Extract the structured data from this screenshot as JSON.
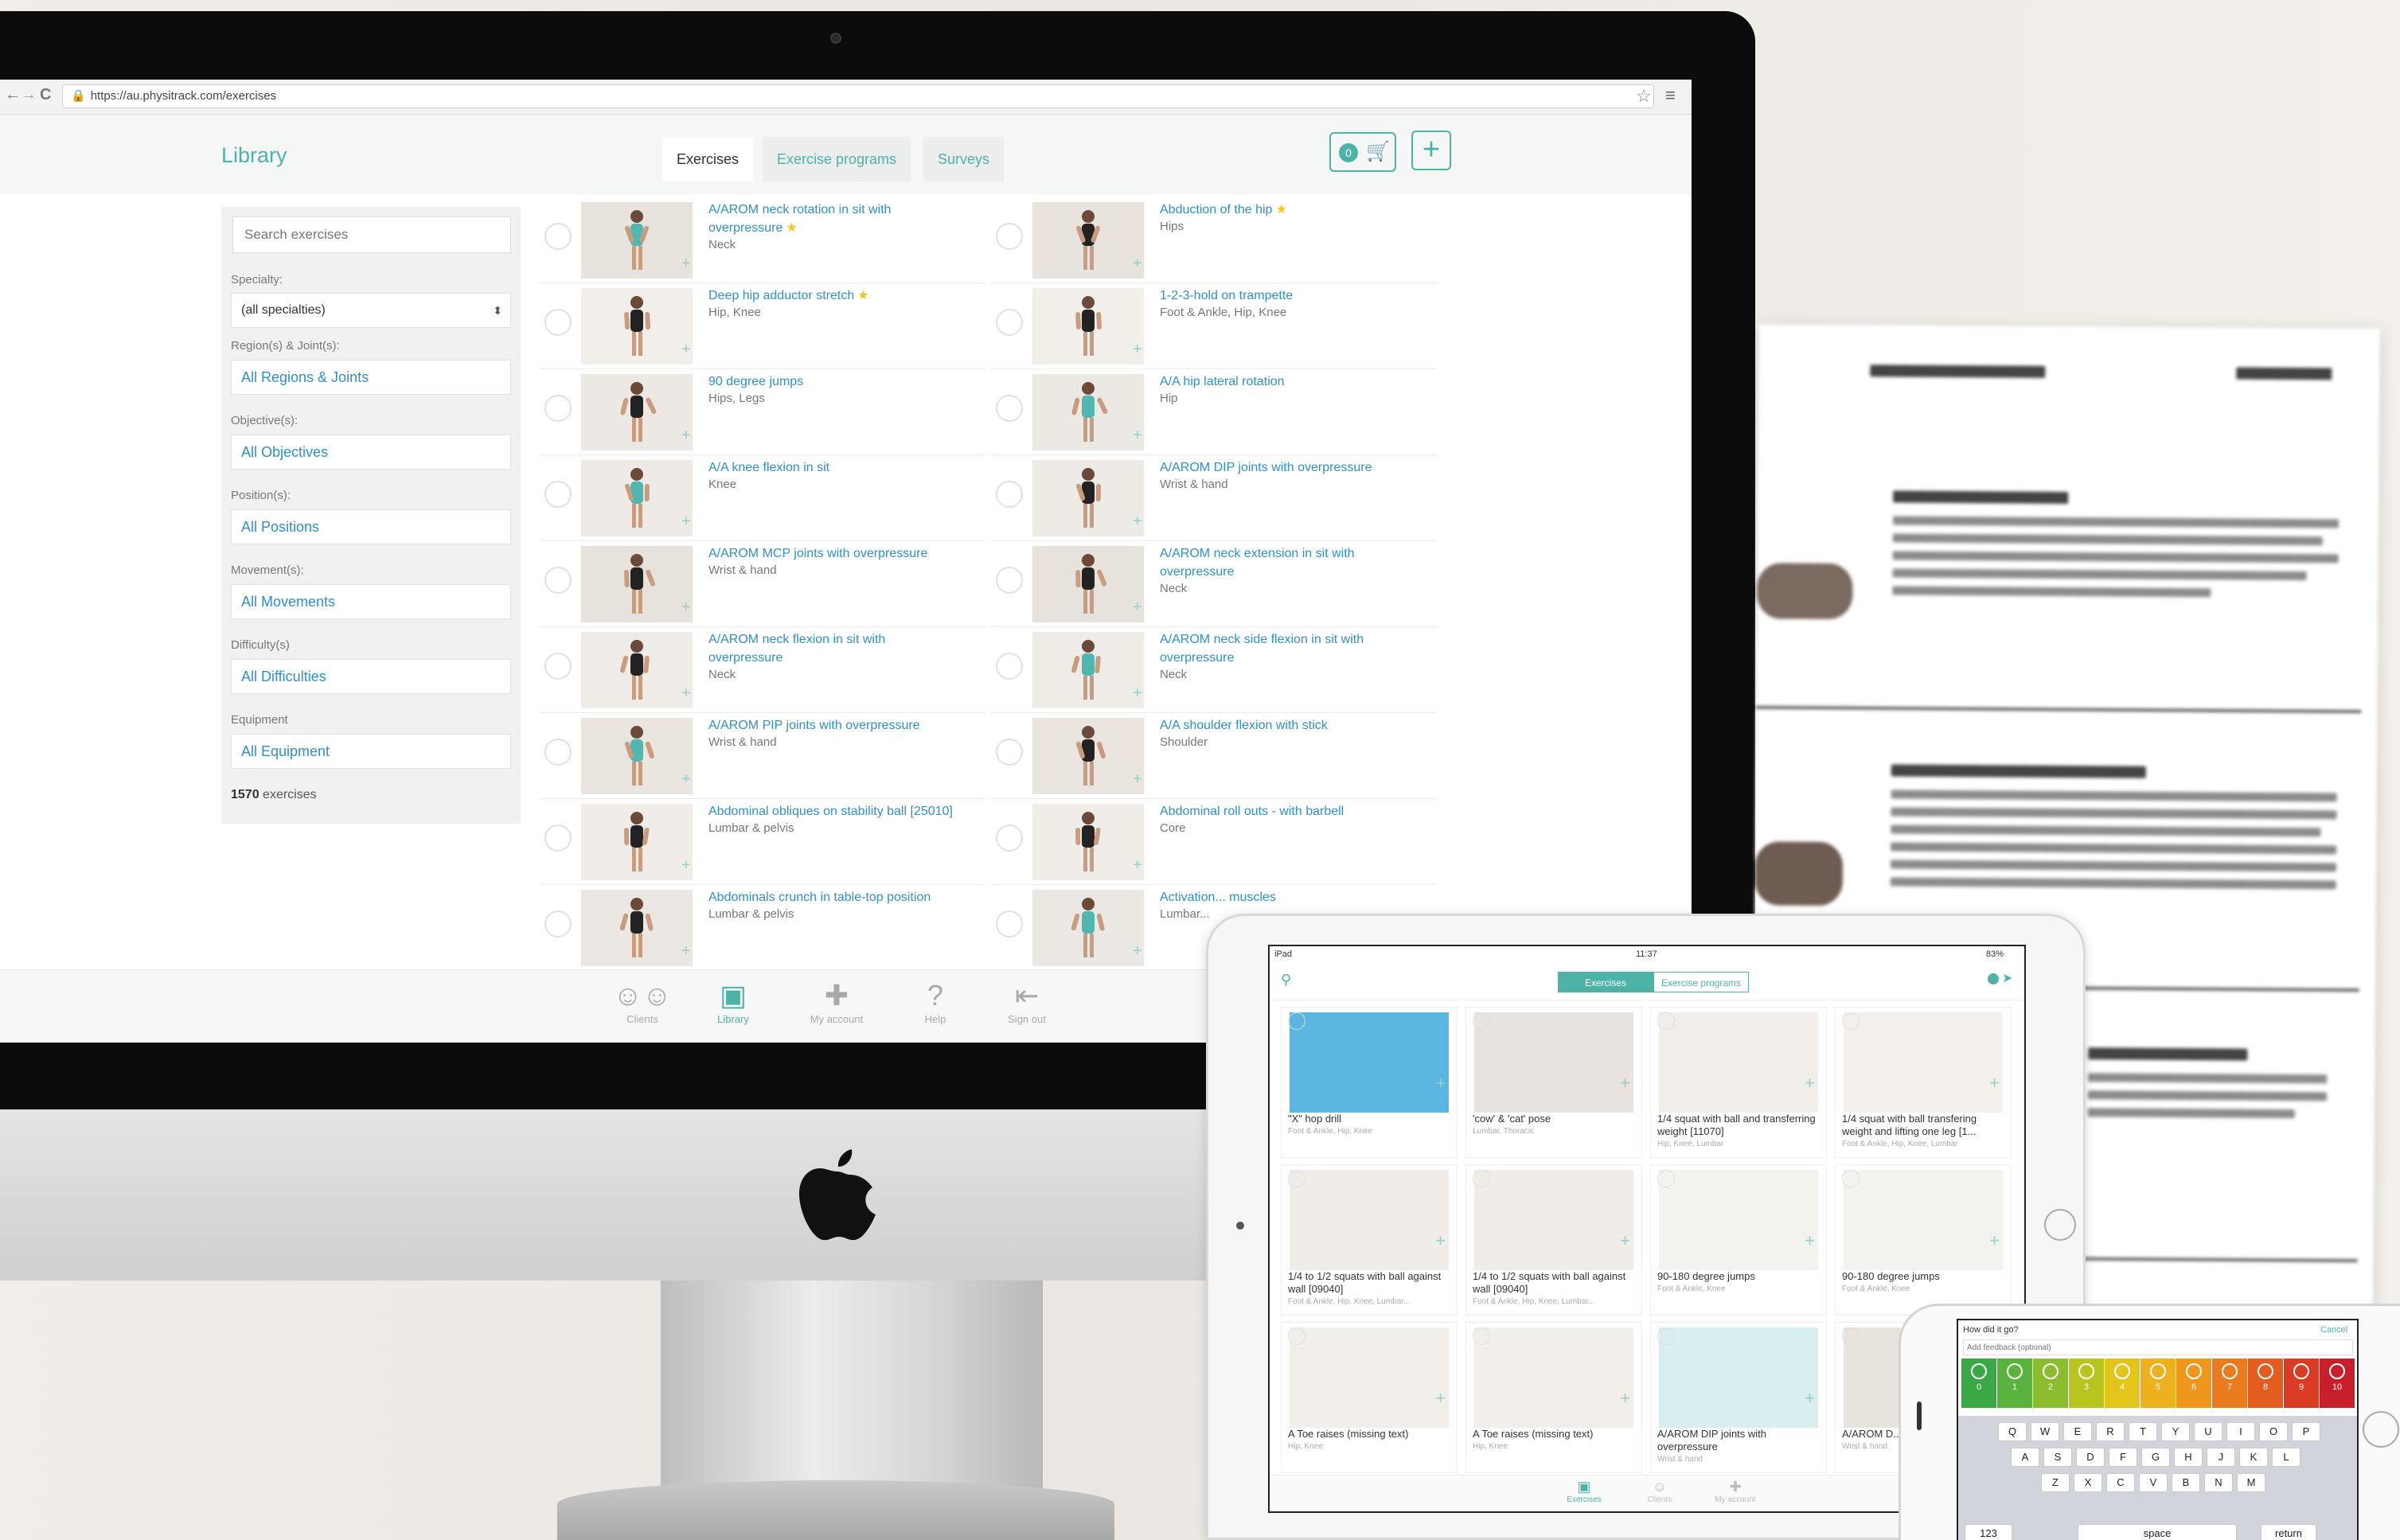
{
  "browser": {
    "url": "https://au.physitrack.com/exercises",
    "nav_back": "←",
    "nav_forward": "→",
    "nav_reload": "C"
  },
  "header": {
    "title": "Library",
    "tabs": [
      {
        "label": "Exercises",
        "active": true
      },
      {
        "label": "Exercise programs",
        "active": false
      },
      {
        "label": "Surveys",
        "active": false
      }
    ],
    "basket_count": "0",
    "add_label": "+"
  },
  "filters": {
    "search_placeholder": "Search exercises",
    "specialty_label": "Specialty:",
    "specialty_value": "(all specialties)",
    "region_label": "Region(s) & Joint(s):",
    "region_value": "All Regions & Joints",
    "objective_label": "Objective(s):",
    "objective_value": "All Objectives",
    "position_label": "Position(s):",
    "position_value": "All Positions",
    "movement_label": "Movement(s):",
    "movement_value": "All Movements",
    "difficulty_label": "Difficulty(s)",
    "difficulty_value": "All Difficulties",
    "equipment_label": "Equipment",
    "equipment_value": "All Equipment",
    "count": "1570",
    "count_suffix": "exercises"
  },
  "exercises_left": [
    {
      "name": "A/AROM neck rotation in sit with overpressure",
      "star": true,
      "region": "Neck"
    },
    {
      "name": "Deep hip adductor stretch",
      "star": true,
      "region": "Hip, Knee"
    },
    {
      "name": "90 degree jumps",
      "star": false,
      "region": "Hips, Legs"
    },
    {
      "name": "A/A knee flexion in sit",
      "star": false,
      "region": "Knee"
    },
    {
      "name": "A/AROM MCP joints with overpressure",
      "star": false,
      "region": "Wrist & hand"
    },
    {
      "name": "A/AROM neck flexion in sit with overpressure",
      "star": false,
      "region": "Neck"
    },
    {
      "name": "A/AROM PIP joints with overpressure",
      "star": false,
      "region": "Wrist & hand"
    },
    {
      "name": "Abdominal obliques on stability ball [25010]",
      "star": false,
      "region": "Lumbar & pelvis"
    },
    {
      "name": "Abdominals crunch in table-top position",
      "star": false,
      "region": "Lumbar & pelvis"
    }
  ],
  "exercises_right": [
    {
      "name": "Abduction of the hip",
      "star": true,
      "region": "Hips"
    },
    {
      "name": "1-2-3-hold on trampette",
      "star": false,
      "region": "Foot & Ankle, Hip, Knee"
    },
    {
      "name": "A/A hip lateral rotation",
      "star": false,
      "region": "Hip"
    },
    {
      "name": "A/AROM DIP joints with overpressure",
      "star": false,
      "region": "Wrist & hand"
    },
    {
      "name": "A/AROM neck extension in sit with overpressure",
      "star": false,
      "region": "Neck"
    },
    {
      "name": "A/AROM neck side flexion in sit with overpressure",
      "star": false,
      "region": "Neck"
    },
    {
      "name": "A/A shoulder flexion with stick",
      "star": false,
      "region": "Shoulder"
    },
    {
      "name": "Abdominal roll outs - with barbell",
      "star": false,
      "region": "Core"
    },
    {
      "name": "Activation... muscles",
      "star": false,
      "region": "Lumbar..."
    }
  ],
  "bottom_nav": [
    {
      "label": "Clients",
      "icon": "people-icon",
      "active": false
    },
    {
      "label": "Library",
      "icon": "library-icon",
      "active": true
    },
    {
      "label": "My account",
      "icon": "puzzle-icon",
      "active": false
    },
    {
      "label": "Help",
      "icon": "help-icon",
      "active": false
    },
    {
      "label": "Sign out",
      "icon": "sign-out-icon",
      "active": false
    }
  ],
  "ipad": {
    "status_left": "iPad",
    "status_time": "11:37",
    "status_right": "83%",
    "seg_exercises": "Exercises",
    "seg_programs": "Exercise programs",
    "cards": [
      {
        "title": "\"X\" hop drill",
        "sub": "Foot & Ankle, Hip, Knee"
      },
      {
        "title": "'cow' & 'cat' pose",
        "sub": "Lumbar, Thoracic"
      },
      {
        "title": "1/4 squat with ball and transferring weight [11070]",
        "sub": "Hip, Knee, Lumbar"
      },
      {
        "title": "1/4 squat with ball transfering weight and lifting one leg [1...",
        "sub": "Foot & Ankle, Hip, Knee, Lumbar"
      },
      {
        "title": "1/4 to 1/2 squats with ball against wall [09040]",
        "sub": "Foot & Ankle, Hip, Knee, Lumbar..."
      },
      {
        "title": "1/4 to 1/2 squats with ball against wall [09040]",
        "sub": "Foot & Ankle, Hip, Knee, Lumbar..."
      },
      {
        "title": "90-180 degree jumps",
        "sub": "Foot & Ankle, Knee"
      },
      {
        "title": "90-180 degree jumps",
        "sub": "Foot & Ankle, Knee"
      },
      {
        "title": "A Toe raises (missing text)",
        "sub": "Hip, Knee"
      },
      {
        "title": "A Toe raises (missing text)",
        "sub": "Hip, Knee"
      },
      {
        "title": "A/AROM DIP joints with overpressure",
        "sub": "Wrist & hand"
      },
      {
        "title": "A/AROM D... overpress...",
        "sub": "Wrist & hand"
      }
    ],
    "bottom_nav": [
      "Exercises",
      "Clients",
      "My account"
    ]
  },
  "iphone": {
    "prompt": "How did it go?",
    "cancel": "Cancel",
    "feedback_placeholder": "Add feedback (optional)",
    "mood_scale": [
      "0",
      "1",
      "2",
      "3",
      "4",
      "5",
      "6",
      "7",
      "8",
      "9",
      "10"
    ],
    "mood_colors": [
      "#3aa845",
      "#5ab33c",
      "#8cbd2f",
      "#b9c51f",
      "#e2c51a",
      "#eeb01c",
      "#ef961d",
      "#ea7b1f",
      "#e35c20",
      "#d93c22",
      "#c8202a"
    ],
    "key_rows": [
      [
        "Q",
        "W",
        "E",
        "R",
        "T",
        "Y",
        "U",
        "I",
        "O",
        "P"
      ],
      [
        "A",
        "S",
        "D",
        "F",
        "G",
        "H",
        "J",
        "K",
        "L"
      ],
      [
        "Z",
        "X",
        "C",
        "V",
        "B",
        "N",
        "M"
      ]
    ],
    "space_label": "space",
    "return_label": "return",
    "numbers_label": "123"
  },
  "colors": {
    "accent": "#4db3a7",
    "link": "#2f8fd1",
    "star": "#f5c518"
  }
}
